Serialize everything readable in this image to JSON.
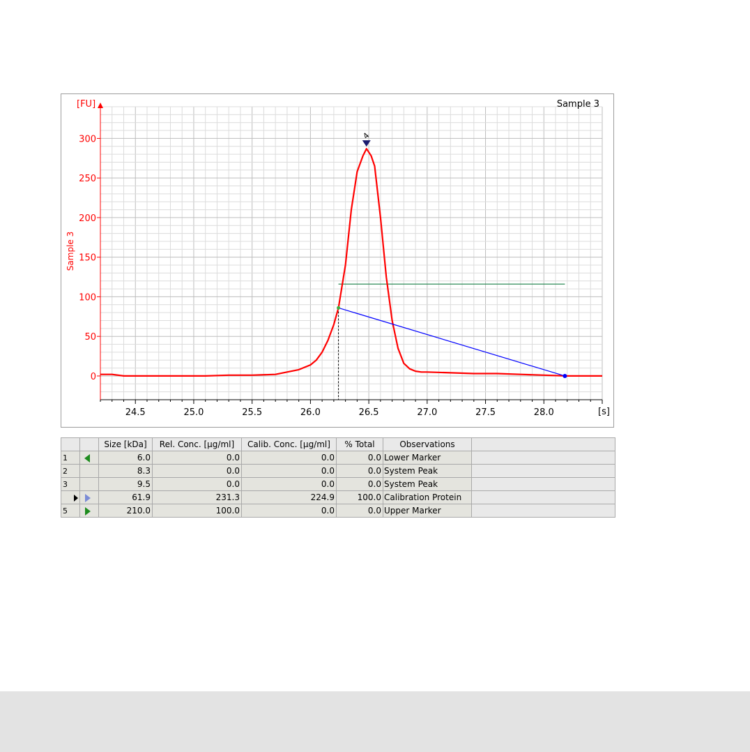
{
  "chart_data": {
    "type": "line",
    "title": "Sample 3",
    "ylabel": "Sample 3",
    "y_unit": "[FU]",
    "x_unit": "[s]",
    "xlim": [
      24.2,
      28.5
    ],
    "ylim": [
      -30,
      340
    ],
    "x_ticks": [
      24.5,
      25.0,
      25.5,
      26.0,
      26.5,
      27.0,
      27.5,
      28.0
    ],
    "x_tick_labels": [
      "24.5",
      "25.0",
      "25.5",
      "26.0",
      "26.5",
      "27.0",
      "27.5",
      "28.0"
    ],
    "y_ticks": [
      0,
      50,
      100,
      150,
      200,
      250,
      300
    ],
    "y_tick_labels": [
      "0",
      "50",
      "100",
      "150",
      "200",
      "250",
      "300"
    ],
    "grid": true,
    "series": [
      {
        "color": "#ff0000",
        "x": [
          24.2,
          24.3,
          24.4,
          24.5,
          24.7,
          24.9,
          25.1,
          25.3,
          25.5,
          25.7,
          25.8,
          25.9,
          26.0,
          26.05,
          26.1,
          26.15,
          26.2,
          26.24,
          26.3,
          26.35,
          26.4,
          26.45,
          26.48,
          26.52,
          26.55,
          26.6,
          26.65,
          26.7,
          26.75,
          26.8,
          26.85,
          26.9,
          26.95,
          27.0,
          27.2,
          27.4,
          27.6,
          27.8,
          28.0,
          28.2,
          28.5
        ],
        "y": [
          2,
          2,
          0,
          0,
          0,
          0,
          0,
          1,
          1,
          2,
          5,
          8,
          14,
          20,
          30,
          45,
          65,
          86,
          140,
          210,
          258,
          278,
          287,
          278,
          265,
          200,
          125,
          70,
          35,
          16,
          9,
          6,
          5,
          5,
          4,
          3,
          3,
          2,
          1,
          0,
          0
        ]
      }
    ],
    "peak_marker": {
      "x": 26.48,
      "y": 287,
      "label": "4"
    },
    "baseline": {
      "x1": 26.24,
      "y1": 86,
      "x2": 28.18,
      "y2": 0,
      "color": "#0000ff"
    },
    "threshold_line": {
      "x1": 26.24,
      "x2": 28.18,
      "y": 116,
      "color": "#2e8b57"
    },
    "peak_start_dashed_x": 26.24
  },
  "table": {
    "columns": [
      "",
      "",
      "Size [kDa]",
      "Rel. Conc. [µg/ml]",
      "Calib. Conc. [µg/ml]",
      "% Total",
      "Observations",
      ""
    ],
    "rows": [
      {
        "index": "1",
        "marker": "lower",
        "size": "6.0",
        "rel": "0.0",
        "calib": "0.0",
        "total": "0.0",
        "obs": "Lower Marker"
      },
      {
        "index": "2",
        "marker": "",
        "size": "8.3",
        "rel": "0.0",
        "calib": "0.0",
        "total": "0.0",
        "obs": "System Peak"
      },
      {
        "index": "3",
        "marker": "",
        "size": "9.5",
        "rel": "0.0",
        "calib": "0.0",
        "total": "0.0",
        "obs": "System Peak"
      },
      {
        "index": "",
        "marker": "calibration",
        "size": "61.9",
        "rel": "231.3",
        "calib": "224.9",
        "total": "100.0",
        "obs": "Calibration Protein",
        "selected": true
      },
      {
        "index": "5",
        "marker": "upper",
        "size": "210.0",
        "rel": "100.0",
        "calib": "0.0",
        "total": "0.0",
        "obs": "Upper Marker"
      }
    ]
  },
  "colors": {
    "trace": "#ff0000",
    "axis_text": "#ff0000",
    "baseline": "#0000ff",
    "threshold": "#2e8b57",
    "peak_marker": "#1a1a6e",
    "marker_green": "#1e8c1e",
    "marker_blue": "#7b8cd6"
  }
}
